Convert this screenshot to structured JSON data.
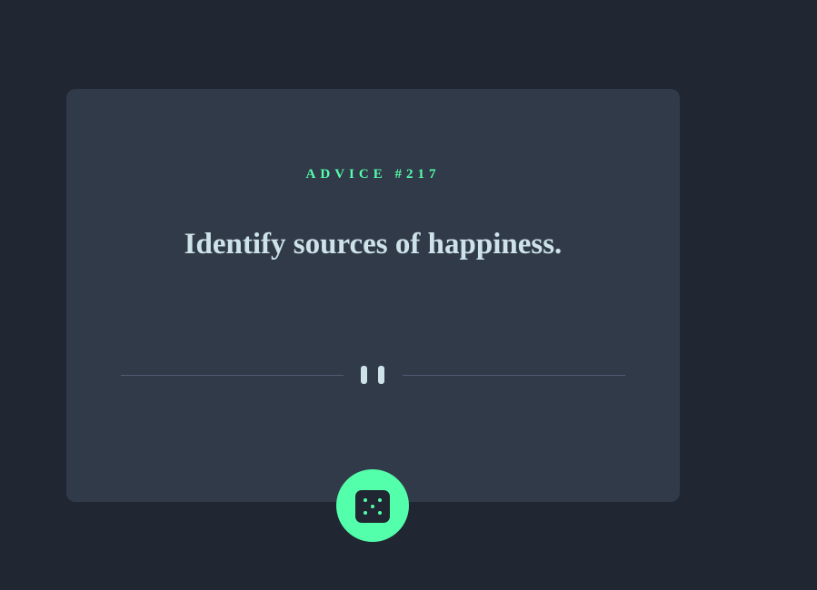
{
  "advice": {
    "label": "ADVICE #217",
    "text": "Identify sources of happiness."
  },
  "divider": {
    "icon": "pause-icon"
  },
  "dice_button": {
    "icon": "dice-icon"
  },
  "colors": {
    "background": "#202632",
    "card": "#313a49",
    "accent": "#53ffaa",
    "text": "#cee3e9",
    "divider": "#4f5d74"
  }
}
